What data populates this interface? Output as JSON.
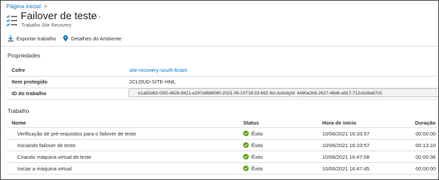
{
  "breadcrumb": {
    "home": "Página inicial",
    "separator": ">"
  },
  "header": {
    "title": "Failover de teste",
    "subtitle": "Trabalho Site Recovery",
    "more": "···",
    "icon": "job-list-icon"
  },
  "toolbar": {
    "export_label": "Exportar trabalho",
    "env_label": "Detalhes do Ambiente"
  },
  "properties": {
    "section_title": "Propriedades",
    "vault_label": "Cofre",
    "vault_value": "site-recovery-south-brazil",
    "protected_item_label": "Item protegido",
    "protected_item_value": "2CLOUD-SITE-HML",
    "job_id_label": "ID do trabalho",
    "job_id_value": "e1a82d63-05f2-462b-8421-e297ef888080-2021-06-10T19:33:48Z-Ibz ActivityId: 4480e2b9-2627-46d6-a917-712cb26a67c5"
  },
  "job": {
    "section_title": "Trabalho",
    "columns": {
      "name": "Nome",
      "status": "Status",
      "start": "Hora de início",
      "duration": "Duração"
    },
    "rows": [
      {
        "name": "Verificação de pré-requisitos para o failover de teste",
        "status": "Êxito",
        "start": "10/06/2021 16:33:57",
        "duration": "00:00:00"
      },
      {
        "name": "Iniciando failover de teste",
        "status": "Êxito",
        "start": "10/06/2021 16:33:57",
        "duration": "00:13:10"
      },
      {
        "name": "Criando máquina virtual de teste",
        "status": "Êxito",
        "start": "10/06/2021 16:47:08",
        "duration": "00:00:36"
      },
      {
        "name": "Iniciar a máquina virtual",
        "status": "Êxito",
        "start": "10/06/2021 16:47:45",
        "duration": "00:00:00"
      }
    ]
  },
  "colors": {
    "link": "#0078d4",
    "success": "#57a300",
    "border": "#e1dfdd"
  }
}
